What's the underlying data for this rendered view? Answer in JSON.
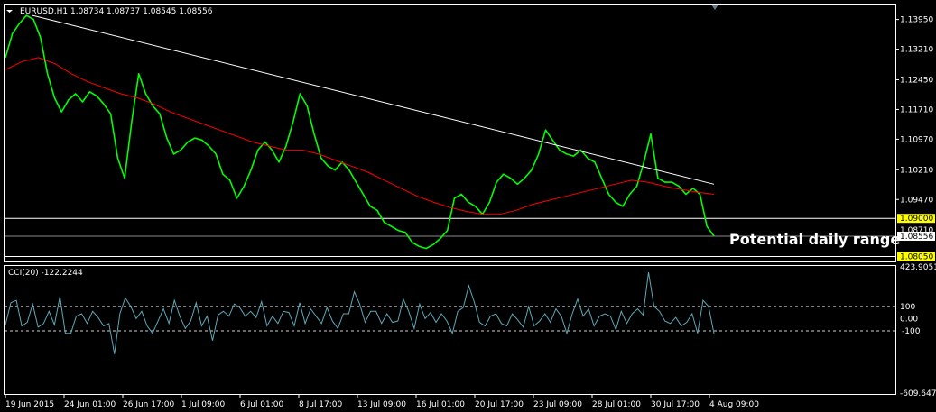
{
  "window": {
    "symbol_info": "EURUSD,H1 1.08734 1.08737 1.08545 1.08556",
    "indicator_info": "CCI(20) -122.2244"
  },
  "annotation": {
    "label": "Potential daily range"
  },
  "colors": {
    "background": "#000000",
    "price": "#00ff00",
    "ma": "#ff0000",
    "trendline": "#ffffff",
    "level": "#ffffff",
    "cci": "#5ea9b7",
    "axis_text": "#ffffff",
    "level_tag_bg": "#ffff00"
  },
  "chart_data": [
    {
      "type": "line",
      "panel": "price",
      "ylim": [
        1.0795,
        1.143
      ],
      "y_ticks": [
        "1.13950",
        "1.13210",
        "1.12450",
        "1.11710",
        "1.10970",
        "1.10210",
        "1.09470"
      ],
      "x_ticks": [
        "19 Jun 2015",
        "24 Jun 01:00",
        "26 Jun 17:00",
        "1 Jul 09:00",
        "6 Jul 01:00",
        "8 Jul 17:00",
        "13 Jul 09:00",
        "16 Jul 01:00",
        "20 Jul 17:00",
        "23 Jul 09:00",
        "28 Jul 01:00",
        "30 Jul 17:00",
        "4 Aug 09:00"
      ],
      "current_price": "1.08556",
      "current_value": 1.08556,
      "levels": [
        {
          "label": "1.09000",
          "value": 1.09
        },
        {
          "label": "1.08710",
          "value": 1.0871
        },
        {
          "label": "1.08050",
          "value": 1.0805
        }
      ],
      "series": [
        {
          "values": [
            1.13,
            1.136,
            1.1385,
            1.1405,
            1.1395,
            1.135,
            1.126,
            1.12,
            1.1165,
            1.1195,
            1.121,
            1.119,
            1.1215,
            1.1205,
            1.1185,
            1.116,
            1.105,
            1.1,
            1.114,
            1.126,
            1.121,
            1.118,
            1.116,
            1.11,
            1.106,
            1.107,
            1.109,
            1.11,
            1.1095,
            1.108,
            1.106,
            1.101,
            1.0995,
            1.095,
            1.098,
            1.102,
            1.107,
            1.109,
            1.107,
            1.104,
            1.108,
            1.114,
            1.121,
            1.118,
            1.111,
            1.105,
            1.103,
            1.102,
            1.104,
            1.102,
            1.099,
            1.096,
            1.093,
            1.092,
            1.089,
            1.088,
            1.087,
            1.0865,
            1.084,
            1.083,
            1.0825,
            1.0835,
            1.085,
            1.087,
            1.095,
            1.096,
            1.094,
            1.093,
            1.091,
            1.094,
            1.099,
            1.101,
            1.1,
            1.0985,
            1.1,
            1.102,
            1.106,
            1.112,
            1.1095,
            1.107,
            1.106,
            1.1055,
            1.107,
            1.105,
            1.104,
            1.1,
            1.096,
            1.094,
            1.093,
            1.096,
            1.098,
            1.104,
            1.111,
            1.1,
            1.099,
            1.099,
            1.098,
            1.096,
            1.0975,
            1.096,
            1.088,
            1.0856
          ],
          "color": "#00ff00"
        },
        {
          "values": [
            1.127,
            1.129,
            1.13,
            1.1285,
            1.126,
            1.124,
            1.1225,
            1.121,
            1.12,
            1.1185,
            1.1165,
            1.115,
            1.1135,
            1.112,
            1.1105,
            1.109,
            1.108,
            1.107,
            1.107,
            1.106,
            1.1045,
            1.103,
            1.1015,
            1.0995,
            1.0975,
            1.0955,
            1.094,
            1.0927,
            1.0917,
            1.091,
            1.091,
            1.092,
            1.0935,
            1.0945,
            1.0955,
            1.0965,
            1.0975,
            1.0985,
            1.0995,
            1.099,
            1.098,
            1.0972,
            1.0965,
            1.096
          ],
          "color": "#ff0000"
        },
        {
          "values": [
            1.1405,
            1.0985
          ],
          "color": "#ffffff"
        }
      ]
    },
    {
      "type": "line",
      "panel": "indicator",
      "ylim": [
        -609.6474,
        423.9051
      ],
      "y_ticks": [
        "423.9051",
        "100",
        "0.00",
        "-100",
        "-609.6474"
      ],
      "levels": [
        100,
        -100
      ],
      "current_value": -122.2244,
      "series": [
        {
          "values": [
            -50,
            130,
            150,
            -60,
            -30,
            120,
            -70,
            -40,
            60,
            -50,
            180,
            -120,
            -120,
            20,
            40,
            -40,
            60,
            10,
            -60,
            -40,
            -290,
            40,
            170,
            100,
            0,
            60,
            -60,
            -120,
            -20,
            80,
            -40,
            150,
            20,
            -80,
            -20,
            130,
            -60,
            20,
            -180,
            30,
            60,
            20,
            120,
            90,
            20,
            60,
            10,
            140,
            -60,
            20,
            -40,
            60,
            50,
            -60,
            130,
            -40,
            80,
            20,
            -40,
            90,
            -20,
            -80,
            40,
            40,
            220,
            120,
            -30,
            60,
            60,
            -40,
            40,
            -30,
            -20,
            160,
            60,
            -80,
            120,
            0,
            50,
            -30,
            40,
            -20,
            -120,
            60,
            90,
            270,
            140,
            -30,
            -60,
            20,
            40,
            -40,
            -60,
            40,
            -10,
            -70,
            100,
            -60,
            -20,
            40,
            -30,
            80,
            20,
            -120,
            40,
            160,
            20,
            80,
            -60,
            20,
            40,
            20,
            -90,
            60,
            -40,
            40,
            80,
            30,
            380,
            100,
            60,
            -20,
            -40,
            10,
            -60,
            -30,
            40,
            -120,
            150,
            100,
            -122
          ],
          "color": "#5ea9b7"
        }
      ]
    }
  ]
}
